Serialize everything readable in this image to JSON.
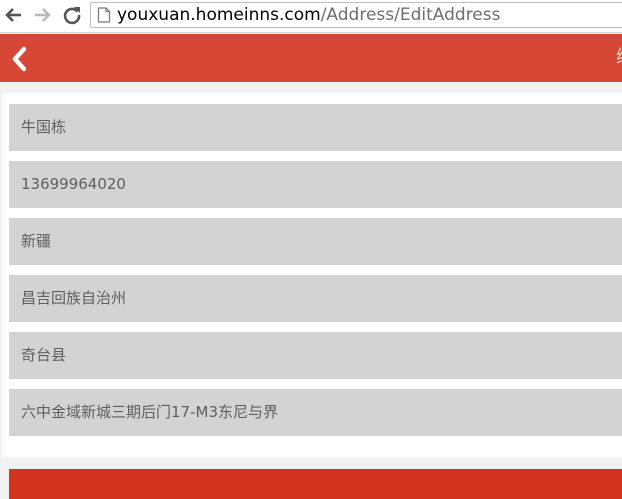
{
  "browser": {
    "url_host": "youxuan.homeinns.com",
    "url_path": "/Address/EditAddress",
    "icons": {
      "back": "arrow-left-icon",
      "forward": "arrow-right-icon",
      "reload": "reload-icon",
      "page": "page-icon"
    }
  },
  "header": {
    "back_icon": "chevron-left-icon",
    "title_fragment": "编",
    "background_color": "#d64736"
  },
  "form": {
    "fields": [
      {
        "name": "name",
        "value": "牛国栋"
      },
      {
        "name": "phone",
        "value": "13699964020"
      },
      {
        "name": "province",
        "value": "新疆"
      },
      {
        "name": "prefecture",
        "value": "昌吉回族自治州"
      },
      {
        "name": "county",
        "value": "奇台县"
      },
      {
        "name": "street-address",
        "value": "六中金域新城三期后门17-M3东尼与界"
      }
    ]
  },
  "footer": {
    "submit_color": "#d4331f"
  }
}
